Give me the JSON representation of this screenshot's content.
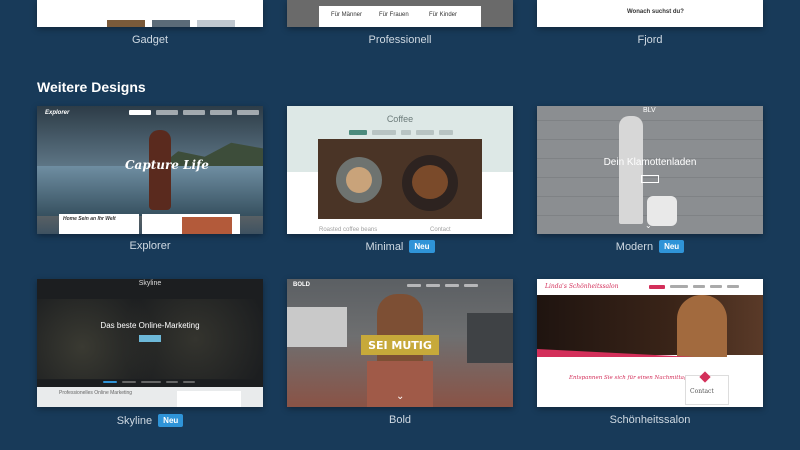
{
  "top_row": [
    {
      "name": "Gadget"
    },
    {
      "name": "Professionell",
      "tabs": [
        "Für Männer",
        "Für Frauen",
        "Für Kinder"
      ]
    },
    {
      "name": "Fjord",
      "search_text": "Wonach suchst du?"
    }
  ],
  "section_title": "Weitere Designs",
  "badge_label": "Neu",
  "designs": [
    {
      "name": "Explorer",
      "brand": "Explorer",
      "hero": "Capture Life",
      "sub": "Home Sein an Ihr Welt"
    },
    {
      "name": "Minimal",
      "badge": true,
      "site_title": "Coffee",
      "footer": "Roasted coffee beans",
      "contact": "Contact"
    },
    {
      "name": "Modern",
      "badge": true,
      "brand": "BLV",
      "hero": "Dein Klamottenladen"
    },
    {
      "name": "Skyline",
      "badge": true,
      "brand": "Skyline",
      "hero": "Das beste Online-Marketing",
      "footer": "Professionelles Online Marketing"
    },
    {
      "name": "Bold",
      "brand": "BOLD",
      "hero": "SEI MUTIG"
    },
    {
      "name": "Schönheitssalon",
      "brand": "Linda's Schönheitssalon",
      "hero": "Entspannen Sie sich für einen Nachmittag",
      "contact": "Contact"
    }
  ]
}
